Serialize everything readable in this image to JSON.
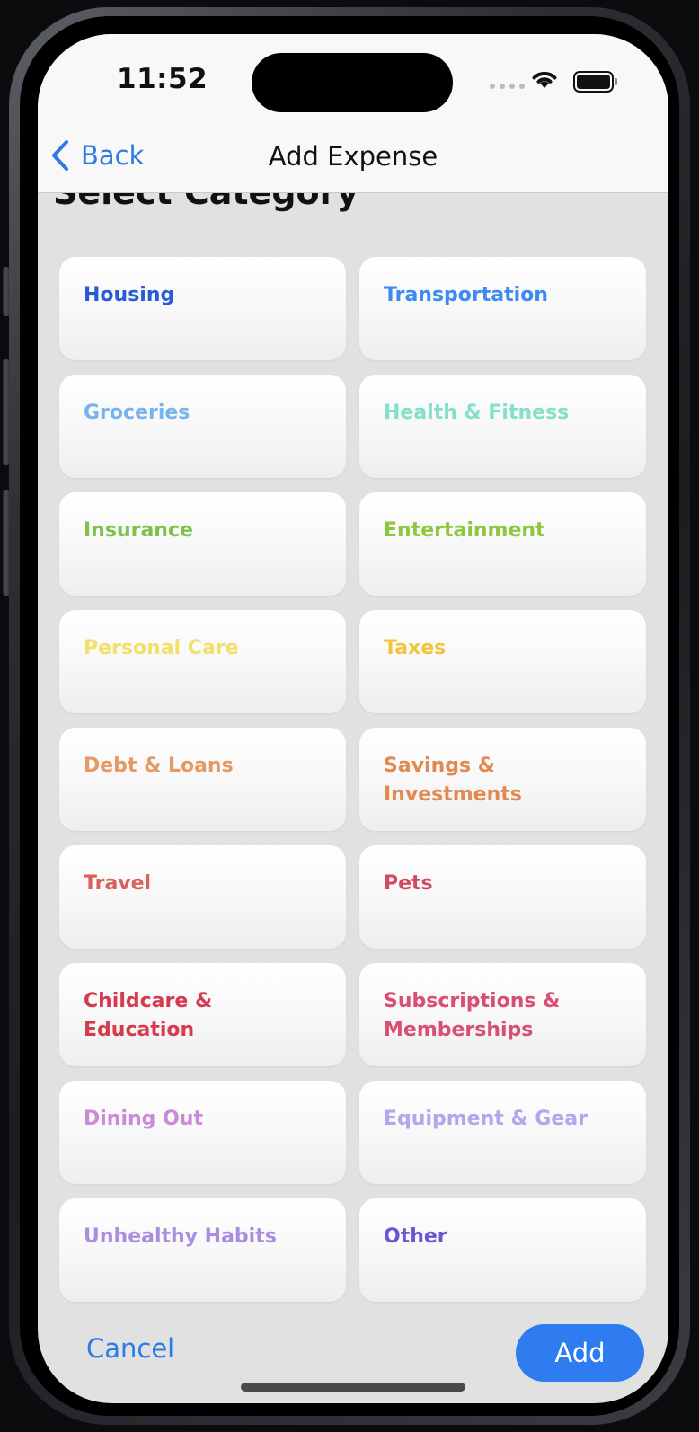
{
  "status_bar": {
    "time": "11:52"
  },
  "nav": {
    "back_label": "Back",
    "title": "Add Expense"
  },
  "section_title": "Select Category",
  "categories": [
    {
      "label": "Housing",
      "color": "#2a5bd7"
    },
    {
      "label": "Transportation",
      "color": "#3d8bf0"
    },
    {
      "label": "Groceries",
      "color": "#76b4ec"
    },
    {
      "label": "Health & Fitness",
      "color": "#84e0c8"
    },
    {
      "label": "Insurance",
      "color": "#7cc24a"
    },
    {
      "label": "Entertainment",
      "color": "#8ec63f"
    },
    {
      "label": "Personal Care",
      "color": "#f0e06c"
    },
    {
      "label": "Taxes",
      "color": "#f2c53d"
    },
    {
      "label": "Debt & Loans",
      "color": "#e59a64"
    },
    {
      "label": "Savings & Investments",
      "color": "#e08a52"
    },
    {
      "label": "Travel",
      "color": "#d9605c"
    },
    {
      "label": "Pets",
      "color": "#d04a5e"
    },
    {
      "label": "Childcare & Education",
      "color": "#d63a4e"
    },
    {
      "label": "Subscriptions & Memberships",
      "color": "#d94f72"
    },
    {
      "label": "Dining Out",
      "color": "#c98ad8"
    },
    {
      "label": "Equipment & Gear",
      "color": "#b7a4ec"
    },
    {
      "label": "Unhealthy Habits",
      "color": "#a88ee0"
    },
    {
      "label": "Other",
      "color": "#6a55d0"
    }
  ],
  "footer": {
    "cancel_label": "Cancel",
    "add_label": "Add"
  },
  "colors": {
    "accent": "#2e7cf0",
    "link": "#2c7be5",
    "screen_bg": "#e1e1e1"
  }
}
